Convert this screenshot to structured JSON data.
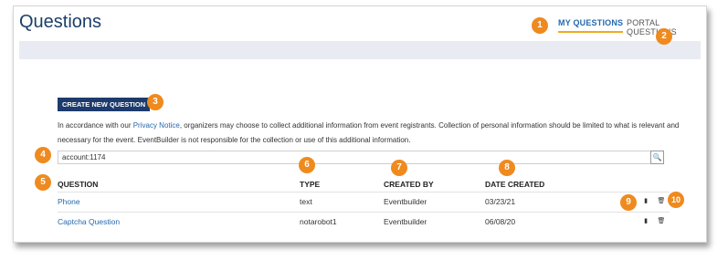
{
  "page": {
    "title": "Questions"
  },
  "tabs": [
    {
      "label": "MY QUESTIONS",
      "active": true
    },
    {
      "label": "PORTAL QUESTIONS",
      "active": false
    }
  ],
  "create_button": "CREATE NEW QUESTION",
  "notice": {
    "before": "In accordance with our ",
    "link": "Privacy Notice",
    "after": ", organizers may choose to collect additional information from event registrants. Collection of personal information should be limited to what is relevant and necessary for the event. EventBuilder is not responsible for the collection or use of this additional information."
  },
  "search": {
    "value": "account:1174",
    "icon": "search-icon"
  },
  "table": {
    "headers": [
      "QUESTION",
      "TYPE",
      "CREATED BY",
      "DATE CREATED"
    ],
    "rows": [
      {
        "question": "Phone",
        "type": "text",
        "created_by": "Eventbuilder",
        "date": "03/23/21"
      },
      {
        "question": "Captcha Question",
        "type": "notarobot1",
        "created_by": "Eventbuilder",
        "date": "06/08/20"
      }
    ],
    "action_icons": [
      "copy-icon",
      "trash-icon"
    ]
  },
  "callouts": [
    "1",
    "2",
    "3",
    "4",
    "5",
    "6",
    "7",
    "8",
    "9",
    "10"
  ],
  "colors": {
    "accent": "#ef8a1f",
    "brand": "#1d3b6c",
    "link": "#2469b0",
    "tab_underline": "#f2a91f"
  }
}
